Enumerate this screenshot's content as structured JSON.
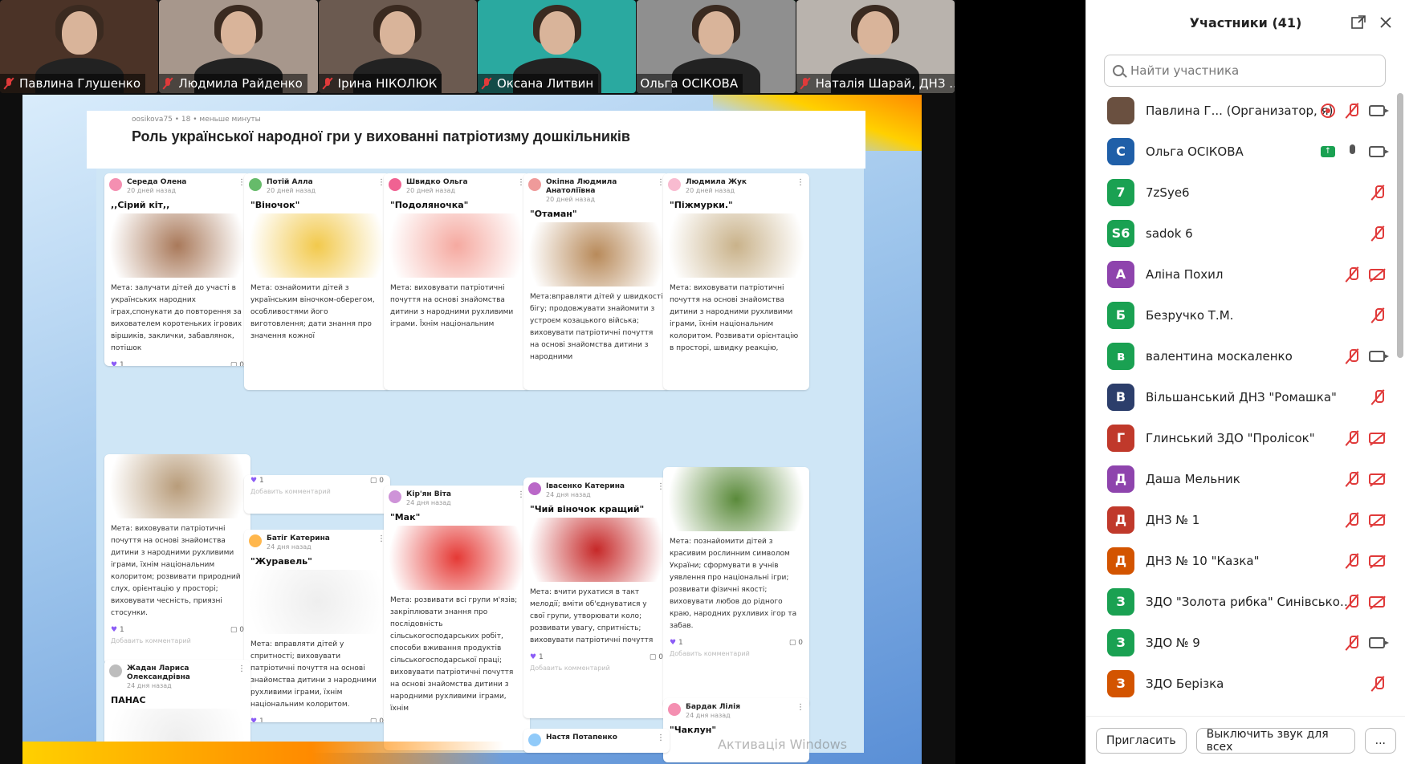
{
  "gallery": [
    {
      "name": "Павлина Глушенко",
      "muted": true,
      "bg": "#4b3327",
      "active": false
    },
    {
      "name": "Людмила Райденко",
      "muted": true,
      "bg": "#a7978c",
      "active": false
    },
    {
      "name": "Ірина НІКОЛЮК",
      "muted": true,
      "bg": "#6b5a50",
      "active": false
    },
    {
      "name": "Оксана Литвин",
      "muted": true,
      "bg": "#2aa9a0",
      "active": false
    },
    {
      "name": "Ольга ОСІКОВА",
      "muted": false,
      "bg": "#8f8f8f",
      "active": true
    },
    {
      "name": "Наталія Шарай, ДНЗ ...",
      "muted": true,
      "bg": "#b9b3ad",
      "active": false
    }
  ],
  "board": {
    "meta": "oosikova75 • 18 • меньше минуты",
    "title": "Роль української народної гри у вихованні патріотизму дошкільників",
    "cards": [
      {
        "author": "Середа Олена",
        "time": "20 дней назад",
        "title": ",,Сірий кіт,,",
        "text": "Мета: залучати дітей до участі в українських народних іграх,спонукати до повторення за вихователем коротеньких ігрових віршиків, заклички, забавлянок, потішок",
        "likes": "1",
        "comments": "0",
        "add": "Добавить комментарий",
        "img": "#a9795a"
      },
      {
        "author": "Потій Алла",
        "time": "20 дней назад",
        "title": "\"Віночок\"",
        "text": "Мета: ознайомити дітей з українським віночком-оберегом, особливостями його виготовлення; дати знання про значення кожної",
        "img": "#f2c94c"
      },
      {
        "author": "Швидко Ольга",
        "time": "20 дней назад",
        "title": "\"Подоляночка\"",
        "text": "Мета: виховувати патріотичні почуття на основі знайомства дитини з народними рухливими іграми. Їхнім національним",
        "img": "#f5a9a0"
      },
      {
        "author": "Окіпна Людмила Анатоліївна",
        "time": "20 дней назад",
        "title": "\"Отаман\"",
        "text": "Мета:вправляти дітей у швидкості бігу; продовжувати знайомити з устроєм козацького війська; виховувати патріотичні почуття на основі знайомства дитини з народними",
        "img": "#b88a5a"
      },
      {
        "author": "Людмила Жук",
        "time": "20 дней назад",
        "title": "\"Піжмурки.\"",
        "text": "Мета: виховувати патріотичні почуття на основі знайомства дитини з народними рухливими іграми, їхнім національним колоритом. Розвивати орієнтацію в просторі, швидку реакцію,",
        "img": "#c9b28a"
      },
      {
        "text": "Мета: виховувати патріотичні почуття на основі знайомства дитини з народними рухливими іграми, їхнім національним колоритом; розвивати природний слух, орієнтацію у просторі; виховувати чесність, приязні стосунки.",
        "likes": "1",
        "comments": "0",
        "add": "Добавить комментарий",
        "img": "#b89c7a"
      },
      {
        "likes": "1",
        "comments": "0",
        "add": "Добавить комментарий"
      },
      {
        "author": "Батіг Катерина",
        "time": "24 дня назад",
        "title": "\"Журавель\"",
        "text": "Мета: вправляти дітей у спритності; виховувати патріотичні почуття на основі знайомства дитини з народними рухливими іграми, їхнім національним колоритом.",
        "likes": "1",
        "comments": "0",
        "img": "#eeeeee"
      },
      {
        "author": "Кір'ян Віта",
        "time": "24 дня назад",
        "title": "\"Мак\"",
        "text": "Мета: розвивати всі групи м'язів; закріплювати знання про послідовність сільськогосподарських робіт, способи вживання продуктів сільськогосподарської праці; виховувати патріотичні почуття на основі знайомства дитини з народними рухливими іграми, їхнім",
        "img": "#e53935"
      },
      {
        "author": "Івасенко Катерина",
        "time": "24 дня назад",
        "title": "\"Чий віночок кращий\"",
        "text": "Мета: вчити рухатися в такт мелодії; вміти об'єднуватися у свої групи, утворювати коло; розвивати увагу, спритність; виховувати патріотичні почуття",
        "likes": "1",
        "comments": "0",
        "add": "Добавить комментарий",
        "img": "#c62828"
      },
      {
        "text": "Мета: познайомити дітей з красивим рослинним символом України; сформувати в учнів уявлення про національні ігри; розвивати фізичні якості; виховувати любов до рідного краю, народних рухливих ігор та забав.",
        "likes": "1",
        "comments": "0",
        "add": "Добавить комментарий",
        "img": "#5a8a3a"
      },
      {
        "author": "Жадан Лариса Олександрівна",
        "time": "24 дня назад",
        "title": "ПАНАС",
        "img": "#eeeeee"
      },
      {
        "author": "Бардак Лілія",
        "time": "24 дня назад",
        "title": "\"Чаклун\""
      },
      {
        "author": "Настя Потапенко"
      }
    ],
    "watermark": "Активація Windows"
  },
  "panel": {
    "title": "Участники (41)",
    "search_placeholder": "Найти участника",
    "participants": [
      {
        "initial": "",
        "name": "Павлина Г...  (Организатор, я)",
        "color": "#6a5040",
        "icons": [
          "rec",
          "mic-off",
          "cam"
        ]
      },
      {
        "initial": "С",
        "name": "Ольга ОСІКОВА",
        "color": "#1f5fa8",
        "icons": [
          "share",
          "mic",
          "cam"
        ]
      },
      {
        "initial": "7",
        "name": "7zSye6",
        "color": "#1aa152",
        "icons": [
          "mic-off"
        ]
      },
      {
        "initial": "S6",
        "name": "sadok 6",
        "color": "#1aa152",
        "icons": [
          "mic-off"
        ]
      },
      {
        "initial": "А",
        "name": "Аліна Похил",
        "color": "#8e44ad",
        "icons": [
          "mic-off",
          "cam-off"
        ]
      },
      {
        "initial": "Б",
        "name": "Безручко Т.М.",
        "color": "#1aa152",
        "icons": [
          "mic-off"
        ]
      },
      {
        "initial": "в",
        "name": "валентина москаленко",
        "color": "#1aa152",
        "icons": [
          "mic-off",
          "cam"
        ]
      },
      {
        "initial": "В",
        "name": "Вільшанський ДНЗ \"Ромашка\"",
        "color": "#2c3e6b",
        "icons": [
          "mic-off"
        ]
      },
      {
        "initial": "Г",
        "name": "Глинський ЗДО \"Пролісок\"",
        "color": "#c0392b",
        "icons": [
          "mic-off",
          "cam-off"
        ]
      },
      {
        "initial": "Д",
        "name": "Даша Мельник",
        "color": "#8e44ad",
        "icons": [
          "mic-off",
          "cam-off"
        ]
      },
      {
        "initial": "Д",
        "name": "ДНЗ № 1",
        "color": "#c0392b",
        "icons": [
          "mic-off",
          "cam-off"
        ]
      },
      {
        "initial": "Д",
        "name": "ДНЗ № 10 \"Казка\"",
        "color": "#d35400",
        "icons": [
          "mic-off",
          "cam-off"
        ]
      },
      {
        "initial": "З",
        "name": "ЗДО \"Золота рибка\" Синівської...",
        "color": "#1aa152",
        "icons": [
          "mic-off",
          "cam-off"
        ]
      },
      {
        "initial": "З",
        "name": "ЗДО № 9",
        "color": "#1aa152",
        "icons": [
          "mic-off",
          "cam"
        ]
      },
      {
        "initial": "З",
        "name": "ЗДО Берізка",
        "color": "#d35400",
        "icons": [
          "mic-off"
        ]
      }
    ],
    "invite": "Пригласить",
    "mute_all": "Выключить звук для всех",
    "more": "..."
  }
}
